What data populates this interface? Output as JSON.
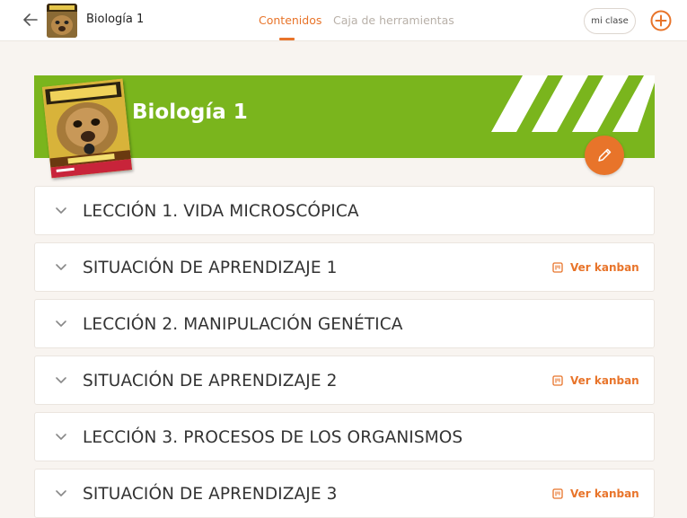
{
  "header": {
    "course_title": "Biología 1",
    "tabs": [
      {
        "label": "Contenidos",
        "active": true
      },
      {
        "label": "Caja de herramientas",
        "active": false
      }
    ],
    "class_button": "mi clase"
  },
  "banner": {
    "title": "Biología 1",
    "color": "#7ab51d"
  },
  "colors": {
    "accent": "#e8742a",
    "background": "#f8f4f0"
  },
  "units": [
    {
      "title": "LECCIÓN 1. VIDA MICROSCÓPICA",
      "kanban": null
    },
    {
      "title": "SITUACIÓN DE APRENDIZAJE 1",
      "kanban": "Ver kanban"
    },
    {
      "title": "LECCIÓN 2. MANIPULACIÓN GENÉTICA",
      "kanban": null
    },
    {
      "title": "SITUACIÓN DE APRENDIZAJE 2",
      "kanban": "Ver kanban"
    },
    {
      "title": "LECCIÓN 3. PROCESOS DE LOS ORGANISMOS",
      "kanban": null
    },
    {
      "title": "SITUACIÓN DE APRENDIZAJE 3",
      "kanban": "Ver kanban"
    }
  ],
  "icons": {
    "back": "arrow-left-icon",
    "add": "plus-circle-icon",
    "edit": "pencil-icon",
    "expand": "chevron-down-icon",
    "kanban": "kanban-board-icon"
  }
}
